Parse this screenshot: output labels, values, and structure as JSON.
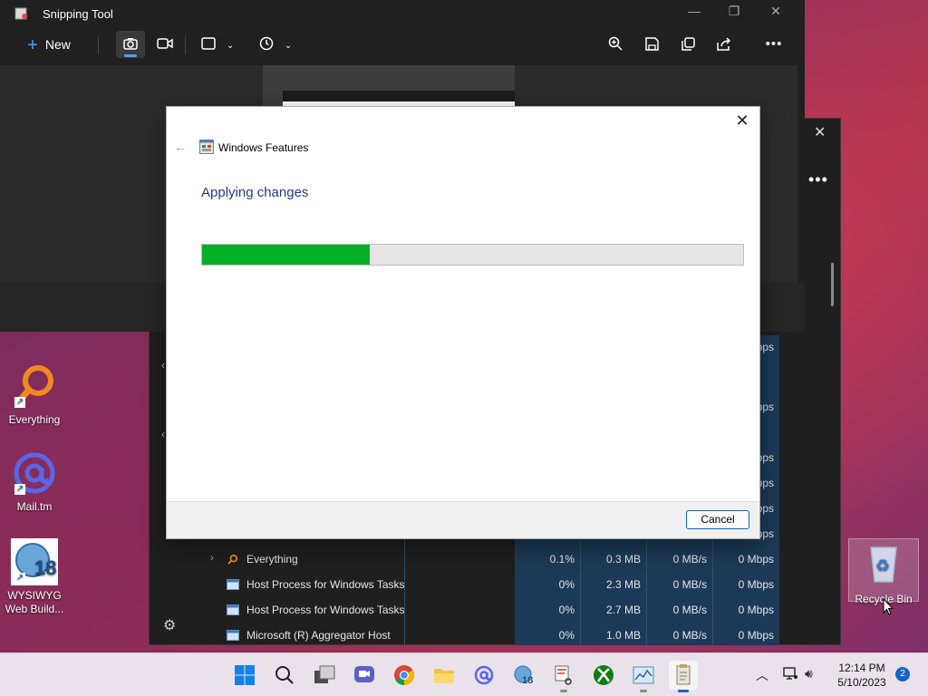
{
  "desktop": {
    "icons": [
      {
        "label": "Everything"
      },
      {
        "label": "Mail.tm"
      },
      {
        "label": "WYSIWYG Web Build..."
      },
      {
        "label": "Recycle Bin"
      }
    ]
  },
  "snipping_tool": {
    "title": "Snipping Tool",
    "new_label": "New"
  },
  "task_manager": {
    "partial_column_values": [
      "bps",
      "Mbps",
      "Mbps",
      "Mbps",
      "Mbps",
      "Mbps"
    ],
    "processes": [
      {
        "name": "Everything",
        "cpu": "0.1%",
        "memory": "0.3 MB",
        "disk": "0 MB/s",
        "network": "0 Mbps"
      },
      {
        "name": "Host Process for Windows Tasks",
        "cpu": "0%",
        "memory": "2.3 MB",
        "disk": "0 MB/s",
        "network": "0 Mbps"
      },
      {
        "name": "Host Process for Windows Tasks",
        "cpu": "0%",
        "memory": "2.7 MB",
        "disk": "0 MB/s",
        "network": "0 Mbps"
      },
      {
        "name": "Microsoft (R) Aggregator Host",
        "cpu": "0%",
        "memory": "1.0 MB",
        "disk": "0 MB/s",
        "network": "0 Mbps"
      }
    ]
  },
  "dialog": {
    "title": "Windows Features",
    "heading": "Applying changes",
    "progress_fraction": 0.31,
    "cancel_label": "Cancel"
  },
  "taskbar": {
    "time": "12:14 PM",
    "date": "5/10/2023",
    "notification_count": "2"
  },
  "colors": {
    "progress_green": "#06b025",
    "heading_blue": "#1e3a8a",
    "accent_blue": "#4aa0ff"
  }
}
